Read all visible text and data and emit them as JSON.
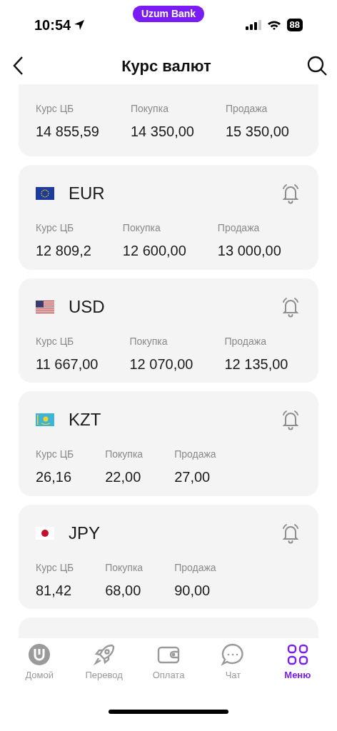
{
  "status_bar": {
    "time": "10:54",
    "app_badge": "Uzum Bank",
    "battery": "88"
  },
  "header": {
    "title": "Курс валют"
  },
  "rates": [
    {
      "kind": "partial",
      "columns": [
        {
          "label": "Курс ЦБ",
          "value": "14 855,59"
        },
        {
          "label": "Покупка",
          "value": "14 350,00"
        },
        {
          "label": "Продажа",
          "value": "15 350,00"
        }
      ]
    },
    {
      "kind": "full",
      "code": "EUR",
      "columns": [
        {
          "label": "Курс ЦБ",
          "value": "12 809,2"
        },
        {
          "label": "Покупка",
          "value": "12 600,00"
        },
        {
          "label": "Продажа",
          "value": "13 000,00"
        }
      ]
    },
    {
      "kind": "full",
      "code": "USD",
      "columns": [
        {
          "label": "Курс ЦБ",
          "value": "11 667,00"
        },
        {
          "label": "Покупка",
          "value": "12 070,00"
        },
        {
          "label": "Продажа",
          "value": "12 135,00"
        }
      ]
    },
    {
      "kind": "full",
      "code": "KZT",
      "columns": [
        {
          "label": "Курс ЦБ",
          "value": "26,16"
        },
        {
          "label": "Покупка",
          "value": "22,00"
        },
        {
          "label": "Продажа",
          "value": "27,00"
        }
      ]
    },
    {
      "kind": "full",
      "code": "JPY",
      "columns": [
        {
          "label": "Курс ЦБ",
          "value": "81,42"
        },
        {
          "label": "Покупка",
          "value": "68,00"
        },
        {
          "label": "Продажа",
          "value": "90,00"
        }
      ]
    },
    {
      "kind": "stub"
    }
  ],
  "tab_bar": [
    {
      "label": "Домой",
      "selected": false
    },
    {
      "label": "Перевод",
      "selected": false
    },
    {
      "label": "Оплата",
      "selected": false
    },
    {
      "label": "Чат",
      "selected": false
    },
    {
      "label": "Меню",
      "selected": true
    }
  ]
}
